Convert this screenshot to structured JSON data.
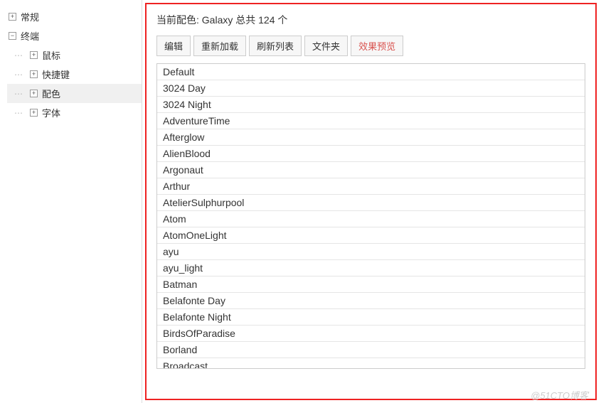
{
  "sidebar": {
    "items": [
      {
        "label": "常规",
        "level": 0,
        "expandable": true,
        "expanded": false,
        "selected": false
      },
      {
        "label": "终端",
        "level": 0,
        "expandable": true,
        "expanded": true,
        "selected": false
      },
      {
        "label": "鼠标",
        "level": 1,
        "expandable": true,
        "expanded": false,
        "selected": false
      },
      {
        "label": "快捷键",
        "level": 1,
        "expandable": true,
        "expanded": false,
        "selected": false
      },
      {
        "label": "配色",
        "level": 1,
        "expandable": true,
        "expanded": false,
        "selected": true
      },
      {
        "label": "字体",
        "level": 1,
        "expandable": true,
        "expanded": false,
        "selected": false
      }
    ]
  },
  "header": {
    "prefix": "当前配色: ",
    "scheme": "Galaxy",
    "middle": " 总共 ",
    "count": "124",
    "suffix": " 个"
  },
  "toolbar": {
    "edit": "编辑",
    "reload": "重新加载",
    "refresh": "刷新列表",
    "folder": "文件夹",
    "preview": "效果预览"
  },
  "themes": [
    "Default",
    "3024 Day",
    "3024 Night",
    "AdventureTime",
    "Afterglow",
    "AlienBlood",
    "Argonaut",
    "Arthur",
    "AtelierSulphurpool",
    "Atom",
    "AtomOneLight",
    "ayu",
    "ayu_light",
    "Batman",
    "Belafonte Day",
    "Belafonte Night",
    "BirdsOfParadise",
    "Borland",
    "Broadcast"
  ],
  "watermark": "@51CTO博客"
}
